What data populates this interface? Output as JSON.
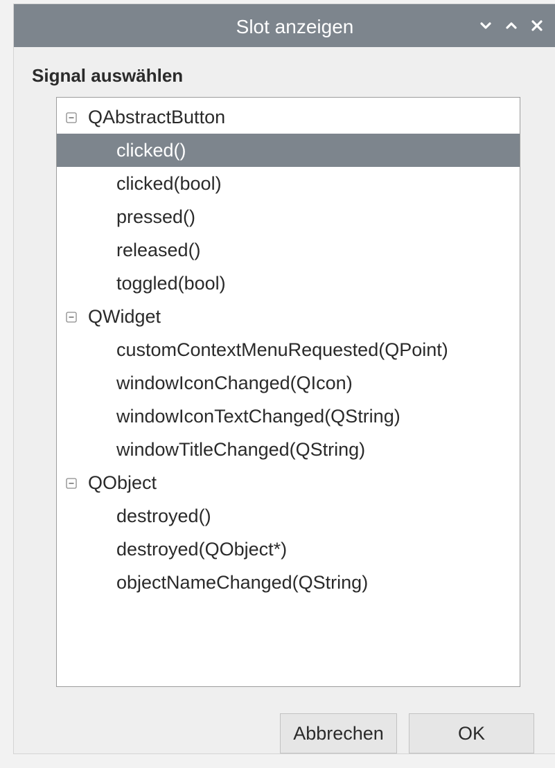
{
  "window": {
    "title": "Slot anzeigen"
  },
  "section": {
    "label": "Signal auswählen"
  },
  "tree": {
    "groups": [
      {
        "name": "QAbstractButton",
        "expanded": true,
        "signals": [
          "clicked()",
          "clicked(bool)",
          "pressed()",
          "released()",
          "toggled(bool)"
        ]
      },
      {
        "name": "QWidget",
        "expanded": true,
        "signals": [
          "customContextMenuRequested(QPoint)",
          "windowIconChanged(QIcon)",
          "windowIconTextChanged(QString)",
          "windowTitleChanged(QString)"
        ]
      },
      {
        "name": "QObject",
        "expanded": true,
        "signals": [
          "destroyed()",
          "destroyed(QObject*)",
          "objectNameChanged(QString)"
        ]
      }
    ],
    "selected": "clicked()"
  },
  "buttons": {
    "cancel_label": "Abbrechen",
    "ok_label": "OK"
  },
  "icons": {
    "minimize": "chevron-down-icon",
    "maximize": "chevron-up-icon",
    "close": "close-icon",
    "collapse": "minus-box-icon"
  },
  "colors": {
    "titlebar": "#7d858d",
    "selection": "#7d858d",
    "window_bg": "#efefef",
    "tree_bg": "#ffffff"
  }
}
